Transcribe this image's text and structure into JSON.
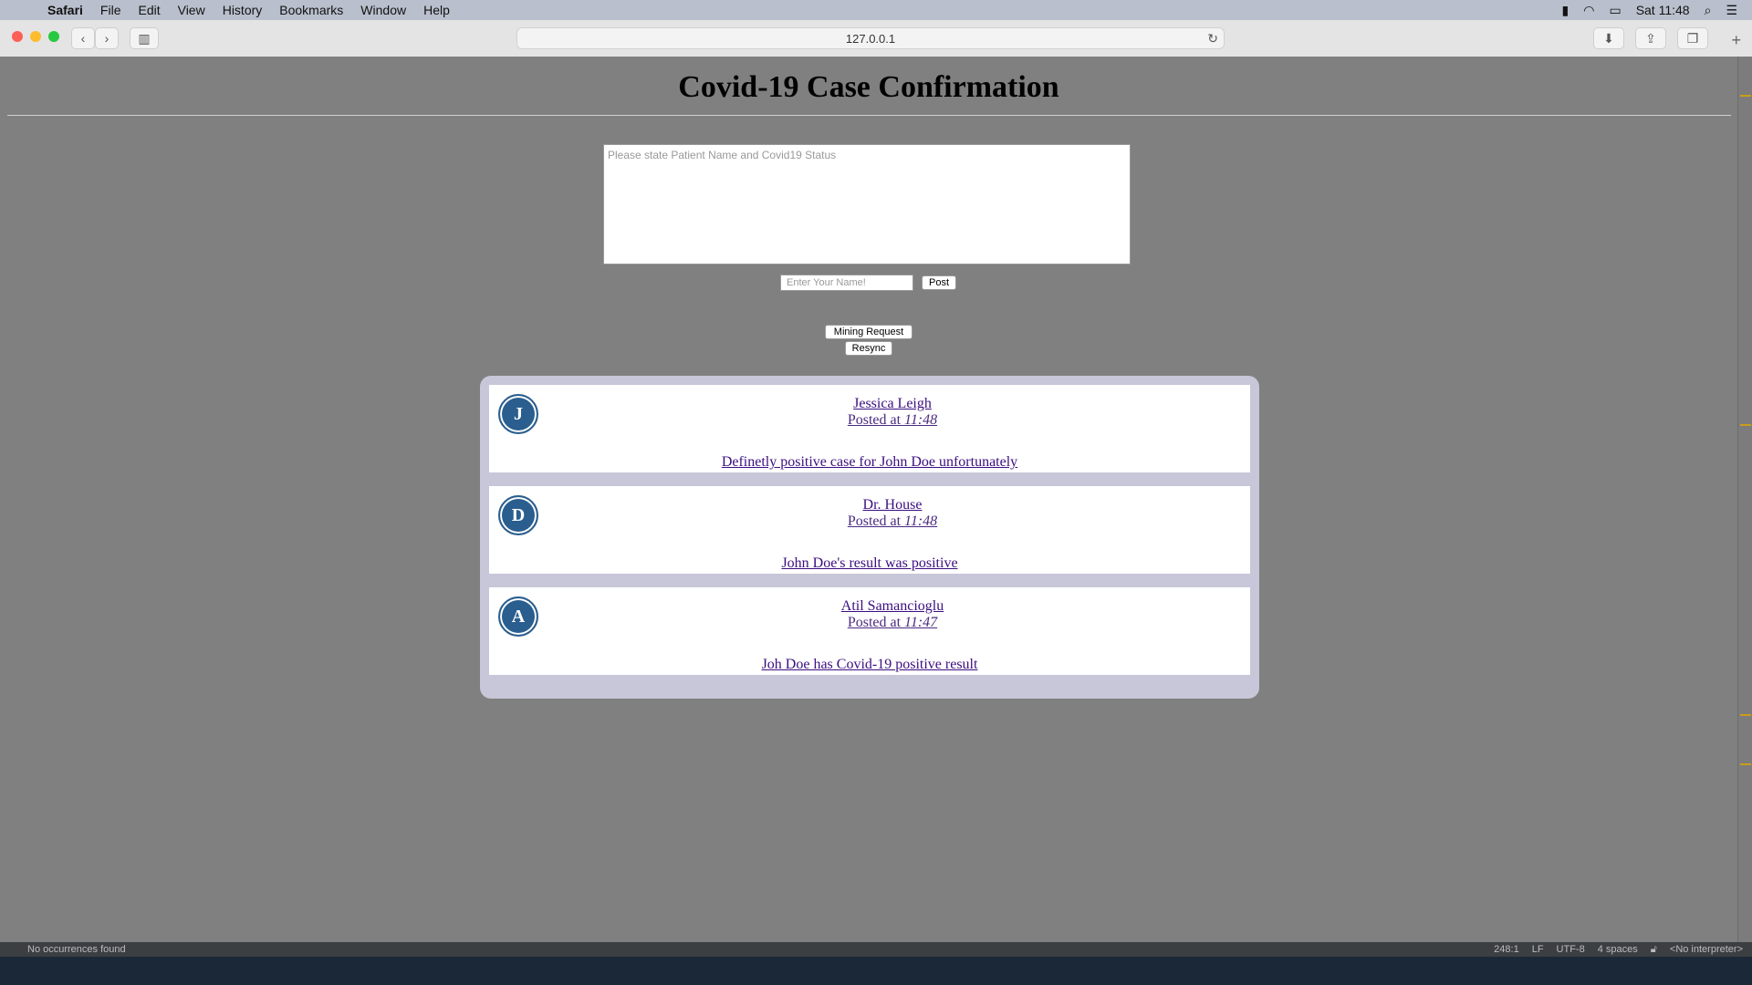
{
  "menubar": {
    "app": "Safari",
    "items": [
      "File",
      "Edit",
      "View",
      "History",
      "Bookmarks",
      "Window",
      "Help"
    ],
    "clock": "Sat 11:48"
  },
  "browser": {
    "url": "127.0.0.1"
  },
  "page": {
    "title": "Covid-19 Case Confirmation",
    "compose_placeholder": "Please state Patient Name and Covid19 Status",
    "name_placeholder": "Enter Your Name!",
    "post_label": "Post",
    "mining_label": "Mining Request",
    "resync_label": "Resync",
    "posts": [
      {
        "initial": "J",
        "author": "Jessica Leigh",
        "posted_prefix": "Posted at",
        "time": "11:48",
        "message": "Definetly positive case for John Doe unfortunately"
      },
      {
        "initial": "D",
        "author": "Dr. House",
        "posted_prefix": "Posted at",
        "time": "11:48",
        "message": "John Doe's result was positive"
      },
      {
        "initial": "A",
        "author": "Atil Samancioglu",
        "posted_prefix": "Posted at",
        "time": "11:47",
        "message": "Joh Doe has Covid-19 positive result"
      }
    ]
  },
  "statusbar": {
    "left": "No occurrences found",
    "position": "248:1",
    "line_ending": "LF",
    "encoding": "UTF-8",
    "indent": "4 spaces",
    "interpreter": "<No interpreter>"
  }
}
